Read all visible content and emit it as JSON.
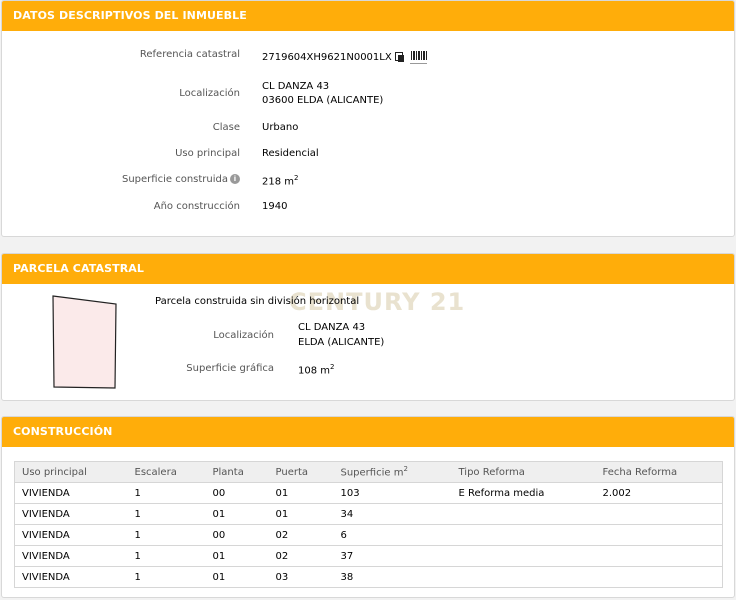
{
  "datos": {
    "header": "DATOS DESCRIPTIVOS DEL INMUEBLE",
    "referencia_label": "Referencia catastral",
    "referencia_value": "2719604XH9621N0001LX",
    "localizacion_label": "Localización",
    "localizacion_line1": "CL DANZA 43",
    "localizacion_line2": "03600 ELDA (ALICANTE)",
    "clase_label": "Clase",
    "clase_value": "Urbano",
    "uso_label": "Uso principal",
    "uso_value": "Residencial",
    "superficie_label": "Superficie construida",
    "superficie_value": "218 m",
    "superficie_sup": "2",
    "anio_label": "Año construcción",
    "anio_value": "1940"
  },
  "parcela": {
    "header": "PARCELA CATASTRAL",
    "descripcion": "Parcela construida sin división horizontal",
    "localizacion_label": "Localización",
    "localizacion_line1": "CL DANZA 43",
    "localizacion_line2": "ELDA (ALICANTE)",
    "superficie_label": "Superficie gráfica",
    "superficie_value": "108 m",
    "superficie_sup": "2",
    "watermark": "CENTURY 21"
  },
  "construccion": {
    "header": "CONSTRUCCIÓN",
    "columns": [
      "Uso principal",
      "Escalera",
      "Planta",
      "Puerta",
      "Superficie m",
      "Tipo Reforma",
      "Fecha Reforma"
    ],
    "superficie_sup": "2",
    "rows": [
      [
        "VIVIENDA",
        "1",
        "00",
        "01",
        "103",
        "E Reforma media",
        "2.002"
      ],
      [
        "VIVIENDA",
        "1",
        "01",
        "01",
        "34",
        "",
        ""
      ],
      [
        "VIVIENDA",
        "1",
        "00",
        "02",
        "6",
        "",
        ""
      ],
      [
        "VIVIENDA",
        "1",
        "01",
        "02",
        "37",
        "",
        ""
      ],
      [
        "VIVIENDA",
        "1",
        "01",
        "03",
        "38",
        "",
        ""
      ]
    ]
  },
  "colors": {
    "header": "#ffad0a",
    "parcel_fill": "#fbeaea"
  },
  "icons": [
    "copy-icon",
    "barcode-icon",
    "info-icon"
  ]
}
